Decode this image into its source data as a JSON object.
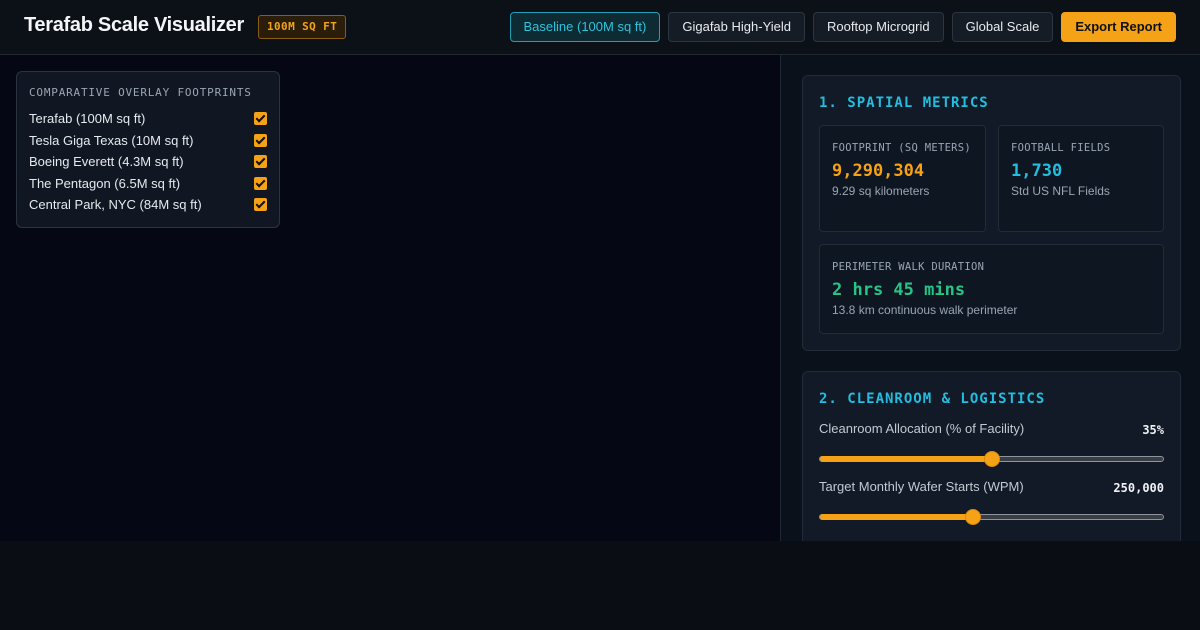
{
  "header": {
    "title": "Terafab Scale Visualizer",
    "badge": "100M SQ FT",
    "presets": [
      {
        "label": "Baseline (100M sq ft)",
        "active": true
      },
      {
        "label": "Gigafab High-Yield",
        "active": false
      },
      {
        "label": "Rooftop Microgrid",
        "active": false
      },
      {
        "label": "Global Scale",
        "active": false
      }
    ],
    "export_label": "Export Report"
  },
  "overlay": {
    "title": "Comparative Overlay Footprints",
    "items": [
      {
        "label": "Terafab (100M sq ft)",
        "checked": true
      },
      {
        "label": "Tesla Giga Texas (10M sq ft)",
        "checked": true
      },
      {
        "label": "Boeing Everett (4.3M sq ft)",
        "checked": true
      },
      {
        "label": "The Pentagon (6.5M sq ft)",
        "checked": true
      },
      {
        "label": "Central Park, NYC (84M sq ft)",
        "checked": true
      }
    ]
  },
  "spatial": {
    "title": "1. Spatial Metrics",
    "footprint": {
      "label": "Footprint (sq meters)",
      "value": "9,290,304",
      "sub": "9.29 sq kilometers"
    },
    "football": {
      "label": "Football Fields",
      "value": "1,730",
      "sub": "Std US NFL Fields"
    },
    "walk": {
      "label": "Perimeter Walk Duration",
      "value": "2 hrs 45 mins",
      "sub": "13.8 km continuous walk perimeter"
    }
  },
  "cleanroom": {
    "title": "2. Cleanroom & Logistics",
    "allocation": {
      "label": "Cleanroom Allocation (% of Facility)",
      "value": "35%",
      "fraction": 0.5
    },
    "wafer": {
      "label": "Target Monthly Wafer Starts (WPM)",
      "value": "250,000",
      "fraction": 0.445
    }
  },
  "colors": {
    "accent": "#f5a216",
    "cyan": "#22bde0",
    "green": "#27c485"
  }
}
